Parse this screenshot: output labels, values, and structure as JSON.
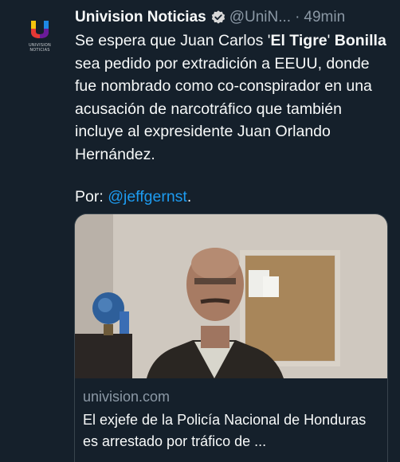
{
  "tweet": {
    "author_name": "Univision Noticias",
    "author_handle": "@UniN...",
    "separator": "·",
    "time": "49min",
    "avatar_label": "UNIVISION NOTICIAS",
    "text": {
      "t1": "Se espera que Juan Carlos '",
      "bold1": "El Tigre",
      "t2": "' ",
      "bold2": "Bonilla",
      "t3": " sea pedido por extradición a EEUU, donde fue nombrado como co-conspirador en una acusación de narcotráfico que también incluye al expresidente Juan Orlando Hernández."
    },
    "byline_prefix": "Por: ",
    "byline_mention": "@jeffgernst",
    "byline_suffix": "."
  },
  "link_card": {
    "domain": "univision.com",
    "title": "El exjefe de la Policía Nacional de Honduras es arrestado por tráfico de ..."
  },
  "colors": {
    "background": "#15202b",
    "link": "#1d9bf0",
    "secondary_text": "#8b98a5",
    "border": "#38444d"
  },
  "icons": [
    "univision-logo-icon",
    "verified-badge-icon",
    "more-options-icon"
  ]
}
